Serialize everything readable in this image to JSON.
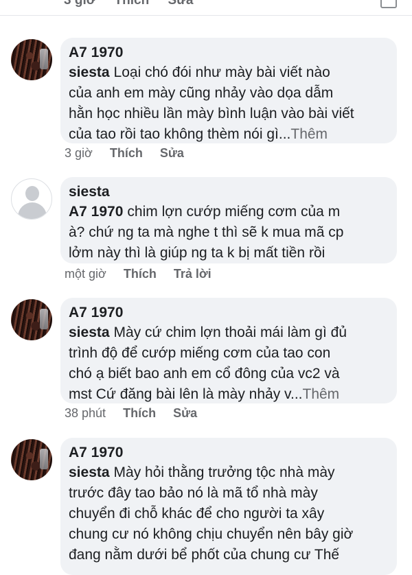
{
  "top_partial": {
    "time": "3 giờ",
    "like": "Thích",
    "edit": "Sửa"
  },
  "comments": [
    {
      "author": "A7 1970",
      "mention": "siesta",
      "lines": [
        "Loại chó đói như mày bài viết nào",
        "của anh em mày cũng nhảy vào dọa dẫm",
        "hằn học nhiều lần mày bình luận vào bài viết",
        "của tao rồi tao không thèm nói gì..."
      ],
      "more": "Thêm",
      "time": "3 giờ",
      "like": "Thích",
      "action2": "Sửa",
      "avatar": "photo"
    },
    {
      "author": "siesta",
      "mention": "A7 1970",
      "lines": [
        "chim lợn cướp miếng cơm của m",
        "à? chứ ng ta mà nghe t thì sẽ k mua mã cp",
        "lởm này thì là giúp ng ta k bị mất tiền rồi"
      ],
      "more": "",
      "time": "một giờ",
      "like": "Thích",
      "action2": "Trả lời",
      "avatar": "default"
    },
    {
      "author": "A7 1970",
      "mention": "siesta",
      "lines": [
        "Mày cứ chim lợn thoải mái làm gì đủ",
        "trình độ để cướp miếng cơm của tao con",
        "chó ạ biết bao anh em cổ đông của vc2 và",
        "mst Cứ đăng bài lên là mày nhảy v..."
      ],
      "more": "Thêm",
      "time": "38 phút",
      "like": "Thích",
      "action2": "Sửa",
      "avatar": "photo"
    },
    {
      "author": "A7 1970",
      "mention": "siesta",
      "lines": [
        "Mày hỏi thằng trưởng tộc nhà mày",
        "trước đây tao bảo nó là mã tổ nhà mày",
        "chuyển đi chỗ khác để cho người ta xây",
        "chung cư nó không chịu chuyển nên bây giờ",
        "đang nằm dưới bể phốt của chung cư Thế"
      ],
      "more": "",
      "avatar": "photo"
    }
  ]
}
